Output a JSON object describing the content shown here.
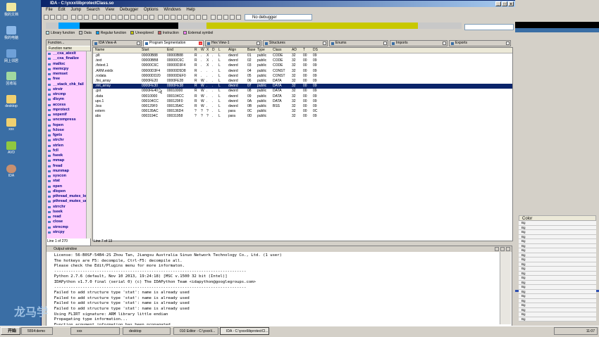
{
  "window": {
    "title": "IDA - C:\\yxxx\\libprotectClass.so",
    "menu": [
      "File",
      "Edit",
      "Jump",
      "Search",
      "View",
      "Debugger",
      "Options",
      "Windows",
      "Help"
    ],
    "debugger_select": "No debugger"
  },
  "legend": [
    "Library function",
    "Data",
    "Regular function",
    "Unexplored",
    "Instruction",
    "External symbol"
  ],
  "legend_colors": [
    "#c0f0ff",
    "#c8c8c8",
    "#00a0ff",
    "#c8c800",
    "#c86060",
    "#ff80ff"
  ],
  "functions_panel": {
    "title": "Function...",
    "column": "Function name",
    "items": [
      "__cxa_atexit",
      "__cxa_finalize",
      "malloc",
      "memcpy",
      "memset",
      "free",
      "__stack_chk_fail",
      "strstr",
      "strcmp",
      "dlsym",
      "access",
      "mprotect",
      "sopenif",
      "uncompress",
      "fopen",
      "fclose",
      "fgets",
      "strchr",
      "strlen",
      "fcll",
      "fseek",
      "mmap",
      "fread",
      "munmap",
      "syscon",
      "stat",
      "open",
      "dlopen",
      "pthread_mutex_lo",
      "pthread_mutex_un",
      "strrchr",
      "lseek",
      "read",
      "close",
      "strncmp",
      "strcpy"
    ],
    "status": "Line 1 of 270"
  },
  "tabs": [
    {
      "label": "IDA View-A"
    },
    {
      "label": "Program Segmentation",
      "closable": true
    },
    {
      "label": "Hex View-1"
    },
    {
      "label": "Structures"
    },
    {
      "label": "Enums"
    },
    {
      "label": "Imports"
    },
    {
      "label": "Exports"
    }
  ],
  "segments": {
    "columns": [
      "Name",
      "Start",
      "End",
      "R",
      "W",
      "X",
      "D",
      "L",
      "Align",
      "Base",
      "Type",
      "Class",
      "AD",
      "T",
      "DS"
    ],
    "rows": [
      [
        ".plt",
        "00000B88",
        "00000B88",
        "R",
        ".",
        "X",
        ".",
        "L",
        "dword",
        "01",
        "public",
        "CODE",
        "32",
        "00",
        "09"
      ],
      [
        ".text",
        "00000BB8",
        "00000C6C",
        "R",
        ".",
        "X",
        ".",
        "L",
        "dword",
        "02",
        "public",
        "CODE",
        "32",
        "00",
        "09"
      ],
      [
        ".ifstext.1",
        "00000C6C",
        "00000D3F4",
        "R",
        ".",
        "X",
        ".",
        "L",
        "dword",
        "03",
        "public",
        "CODE",
        "32",
        "00",
        "09"
      ],
      [
        ".ARM.exidx",
        "00000D3F4",
        "00000D5D8",
        "R",
        ".",
        ".",
        ".",
        "L",
        "dword",
        "04",
        "public",
        "CONST",
        "32",
        "00",
        "09"
      ],
      [
        ".rodata",
        "00000DD20",
        "00000DEF0",
        "R",
        ".",
        ".",
        ".",
        "L",
        "dword",
        "05",
        "public",
        "CONST",
        "32",
        "00",
        "09"
      ],
      [
        ".fini_array",
        "0000FE20",
        "0000FE28",
        "R",
        "W",
        ".",
        ".",
        "L",
        "dword",
        "06",
        "public",
        "DATA",
        "32",
        "00",
        "09"
      ],
      [
        ".init_array",
        "0000FE30",
        "0000FE38",
        "R",
        "W",
        ".",
        ".",
        "L",
        "dword",
        "07",
        "public",
        "DATA",
        "32",
        "00",
        "09"
      ],
      [
        ".got",
        "0000FE40",
        "00010000",
        "R",
        "W",
        ".",
        ".",
        "L",
        "dword",
        "08",
        "public",
        "DATA",
        "32",
        "00",
        "09"
      ],
      [
        ".data",
        "00010000",
        "000104CC",
        "R",
        "W",
        ".",
        ".",
        "L",
        "dword",
        "09",
        "public",
        "DATA",
        "32",
        "00",
        "09"
      ],
      [
        "upx.1",
        "000104CC",
        "000129F0",
        "R",
        "W",
        ".",
        ".",
        "L",
        "dword",
        "0A",
        "public",
        "DATA",
        "32",
        "00",
        "09"
      ],
      [
        ".bss",
        "000129F0",
        "000135AC",
        "R",
        "W",
        ".",
        ".",
        "L",
        "dword",
        "0B",
        "public",
        "BSS",
        "32",
        "00",
        "09"
      ],
      [
        "extern",
        "000135AC",
        "000136D4",
        "?",
        "?",
        "?",
        ".",
        "L",
        "para",
        "0C",
        "public",
        "",
        "32",
        "00",
        "0C"
      ],
      [
        "abs",
        "0003194C",
        "00031958",
        "?",
        "?",
        "?",
        ".",
        "L",
        "para",
        "0D",
        "public",
        "",
        "32",
        "00",
        "09"
      ]
    ],
    "selected_row": 6,
    "status": "Line 7 of 13"
  },
  "output": {
    "title": "Output window",
    "lines": [
      "  License: 56-B0SF-54B4-2S Zhou Tan, Jiangsu Australia Sinuo Network Technology Co., Ltd. (1 user)",
      "  The hotkeys are F5: decompile, Ctrl-F5: decompile all.",
      "  Please check the Edit/Plugins menu for more informaton.",
      "  ---------------------------------------------------------------------------------",
      "  Python 2.7.6 (default, Nov 10 2013, 19:24:18) [MSC v.1500 32 bit (Intel)]",
      "  IDAPython v1.7.0 final (serial 0) (c) The IDAPython Team <idapython@googlegroups.com>",
      "  ---------------------------------------------------------------------------------",
      "  Failed to add structure type 'stat': name is already used",
      "  Failed to add structure type 'stat': name is already used",
      "  Failed to add structure type 'stat': name is already used",
      "  Failed to add structure type 'stat': name is already used",
      "  Using FLIRT signature: ARM library little endian",
      "  Propagating type information...",
      "  Function argument information has been propagated",
      "  The initial autoanalysis has been finished."
    ]
  },
  "right_panel": {
    "color_header": "Color",
    "color_rows": [
      "Bg",
      "Bg",
      "Bg",
      "Bg",
      "Bg",
      "Bg",
      "Bg",
      "Bg",
      "Bg",
      "Bg",
      "Bg",
      "Bg",
      "Bg",
      "Bg",
      "Bg",
      "Bg",
      "Bg",
      "Bg",
      "Bg",
      "Bg",
      "Bg",
      "Bg"
    ]
  },
  "desktop": {
    "icons": [
      "我的文档",
      "我的电脑",
      "网上邻居",
      "回收站",
      "desktop",
      "xxx",
      "AVD",
      "IDA"
    ]
  },
  "taskbar": {
    "start": "开始",
    "tasks": [
      "5554:demo",
      "xxx",
      "desktop",
      "010 Editor - C:\\yxxx\\l...",
      "IDA - C:\\yxxx\\libprotectCl..."
    ],
    "clock": "11:07"
  },
  "watermark": "龙马学"
}
